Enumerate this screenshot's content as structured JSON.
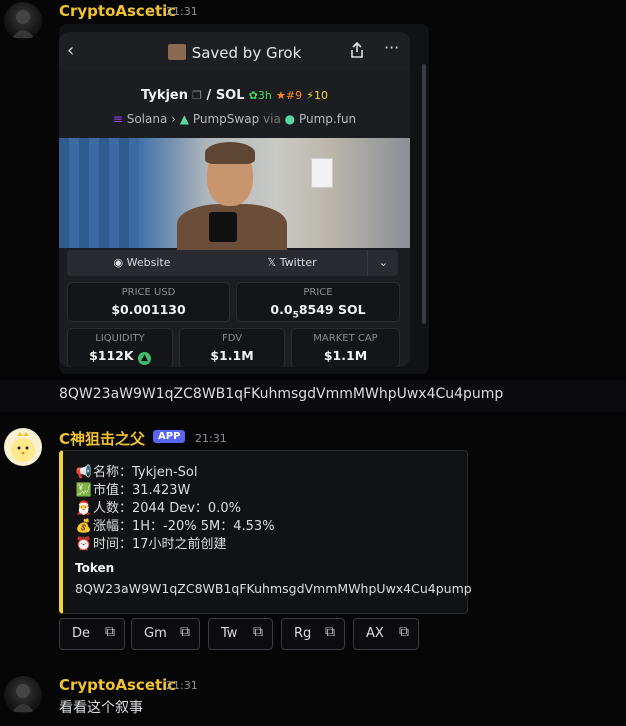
{
  "messages": {
    "first": {
      "username": "CryptoAscetic",
      "time": "21:31"
    },
    "contract_text": "8QW23aW9W1qZC8WB1qFKuhmsgdVmmMWhpUwx4Cu4pump",
    "bot": {
      "username": "C神狙击之父",
      "badge": "APP",
      "time": "21:31"
    },
    "last": {
      "username": "CryptoAscetic",
      "time": "21:31",
      "text": "看看这个叙事"
    }
  },
  "screenshot": {
    "header_title": "Saved by Grok",
    "pair": "Tykjen",
    "pair_quote": " / SOL",
    "pair_age": "3h",
    "pair_rank": "#9",
    "pair_boost": "10",
    "chain": "Solana",
    "dex": "PumpSwap",
    "via_word": "via",
    "launchpad": "Pump.fun",
    "website_label": "Website",
    "twitter_label": "Twitter",
    "stats": {
      "price_usd_label": "PRICE USD",
      "price_usd": "$0.001130",
      "price_label": "PRICE",
      "price_main": "0.0",
      "price_sub": "5",
      "price_tail": "8549 SOL",
      "liquidity_label": "LIQUIDITY",
      "liquidity": "$112K",
      "fdv_label": "FDV",
      "fdv": "$1.1M",
      "mcap_label": "MARKET CAP",
      "mcap": "$1.1M"
    }
  },
  "embed": {
    "lines": [
      {
        "icon": "📢",
        "text": "名称：Tykjen-Sol"
      },
      {
        "icon": "💹",
        "text": "市值：31.423W"
      },
      {
        "icon": "🎅",
        "text": "人数：2044 Dev：0.0%"
      },
      {
        "icon": "💰",
        "text": "涨幅：1H：-20% 5M：4.53%"
      },
      {
        "icon": "⏰",
        "text": "时间：17小时之前创建"
      }
    ],
    "token_label": "Token",
    "token_value": "8QW23aW9W1qZC8WB1qFKuhmsgdVmmMWhpUwx4Cu4pump"
  },
  "buttons": [
    "De",
    "Gm",
    "Tw",
    "Rg",
    "AX"
  ],
  "colors": {
    "username": "#f0c232",
    "embed_accent": "#f0d432",
    "app_badge": "#5865f2",
    "background": "#060606"
  }
}
